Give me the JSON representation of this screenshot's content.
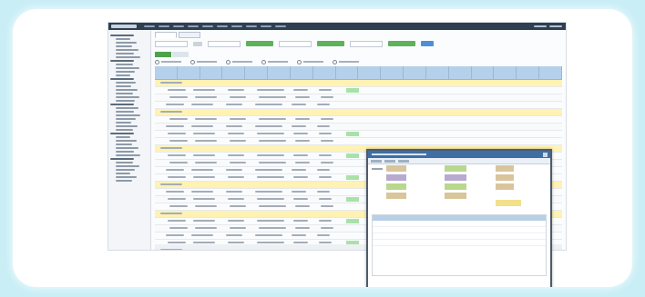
{
  "app": {
    "top_menu": [
      "",
      "",
      "",
      "",
      "",
      "",
      "",
      "",
      "",
      ""
    ],
    "user_links": [
      "",
      ""
    ]
  },
  "sidebar": {
    "groups": [
      {
        "label": "",
        "items": [
          "",
          "",
          "",
          "",
          "",
          ""
        ]
      },
      {
        "label": "",
        "items": [
          "",
          "",
          "",
          ""
        ]
      },
      {
        "label": "",
        "items": [
          "",
          "",
          "",
          "",
          "",
          ""
        ]
      },
      {
        "label": "",
        "items": [
          "",
          "",
          "",
          "",
          "",
          "",
          ""
        ]
      },
      {
        "label": "",
        "items": [
          "",
          "",
          "",
          "",
          "",
          ""
        ]
      },
      {
        "label": "",
        "items": [
          "",
          "",
          "",
          "",
          "",
          ""
        ]
      }
    ]
  },
  "main": {
    "tabs": [
      "",
      ""
    ],
    "subtabs": [
      "",
      ""
    ],
    "filters": [
      "",
      "",
      "",
      ""
    ],
    "options": [
      "",
      "",
      "",
      "",
      "",
      ""
    ]
  },
  "popup": {
    "title": "",
    "buttons": [
      "",
      ""
    ]
  }
}
